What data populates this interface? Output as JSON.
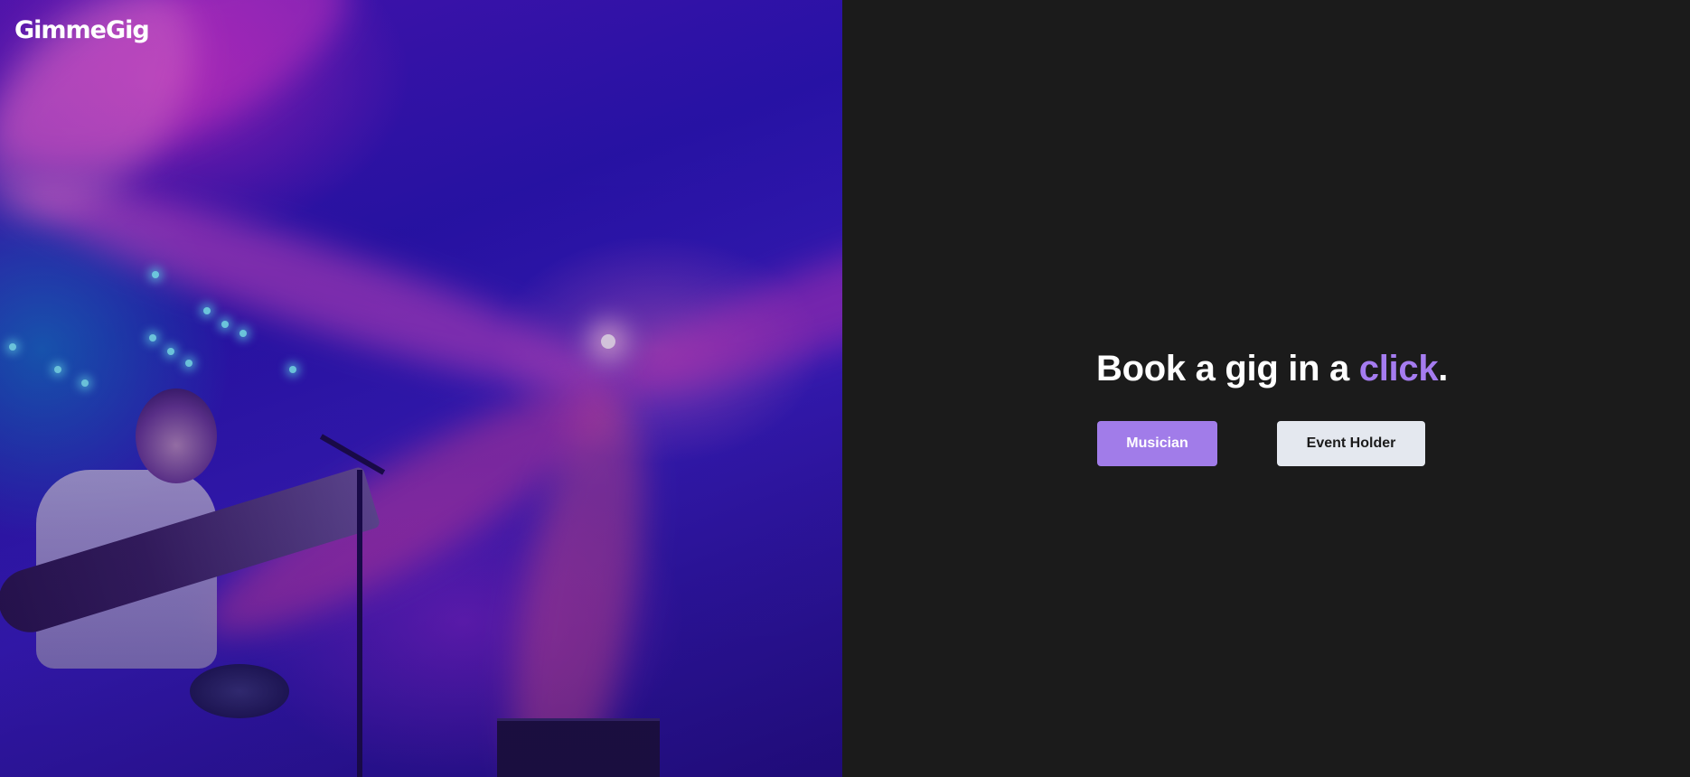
{
  "brand": {
    "logo_text": "GimmeGig"
  },
  "hero": {
    "image_name": "concert-stage-photo"
  },
  "cta": {
    "headline_prefix": "Book a gig in a ",
    "headline_accent": "click",
    "headline_suffix": ".",
    "musician_button": "Musician",
    "event_holder_button": "Event Holder"
  },
  "colors": {
    "background": "#1b1b1b",
    "accent": "#a57cf0",
    "primary_button": "#a17ce9",
    "secondary_button": "#e4e8ef",
    "hero_tint": "#2a15b5"
  }
}
